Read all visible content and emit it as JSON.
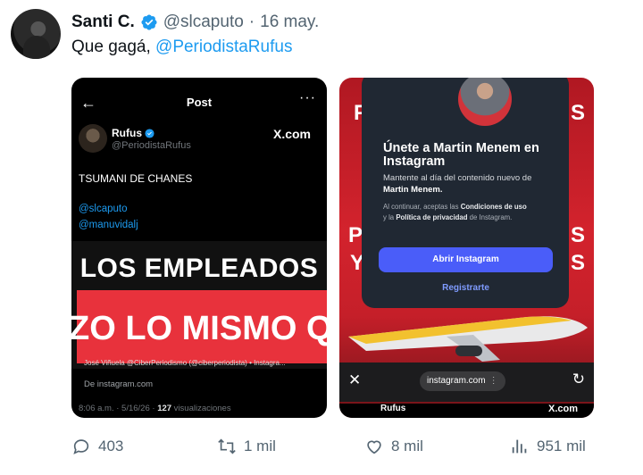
{
  "tweet": {
    "author_name": "Santi C.",
    "handle": "@slcaputo",
    "separator": "·",
    "date": "16 may.",
    "text": "Que gagá,",
    "mention": "@PeriodistaRufus"
  },
  "media_left": {
    "header_title": "Post",
    "back_glyph": "←",
    "more_glyph": "···",
    "author_name": "Rufus",
    "author_handle": "@PeriodistaRufus",
    "brand": "X.com",
    "text": "TSUMANI DE CHANES",
    "mention1": "@slcaputo",
    "mention2": "@manuvidalj",
    "video_line1": "LOS EMPLEADOS",
    "video_line2": "ZO LO MISMO Q",
    "video_caption": "José Viñuela @CiberPeriodismo (@ciberperiodista) • Instagra...",
    "source": "De instagram.com",
    "meta_time": "8:06 a.m. · 5/16/26 · ",
    "meta_views_num": "127",
    "meta_views_label": " visualizaciones"
  },
  "media_right": {
    "bg_letters": [
      "F",
      "S",
      "P",
      "S",
      "Y",
      "S"
    ],
    "modal_title": "Únete a Martin Menem en Instagram",
    "modal_body_1": "Mantente al día del contenido nuevo de",
    "modal_body_name": "Martin Menem.",
    "terms_1": "Al continuar, aceptas las ",
    "terms_link1": "Condiciones de uso",
    "terms_2": " y la ",
    "terms_link2": "Política de privacidad",
    "terms_3": " de Instagram.",
    "open_button": "Abrir Instagram",
    "register_link": "Registrarte",
    "close_glyph": "✕",
    "url": "instagram.com",
    "url_more": "⋮",
    "reload_glyph": "↻",
    "footer_name": "Rufus",
    "footer_brand": "X.com"
  },
  "actions": {
    "replies": "403",
    "reposts": "1 mil",
    "likes": "8 mil",
    "views": "951 mil"
  },
  "colors": {
    "accent": "#1d9bf0",
    "instagram_button": "#4a5df9",
    "red_bg": "#e8323c"
  }
}
